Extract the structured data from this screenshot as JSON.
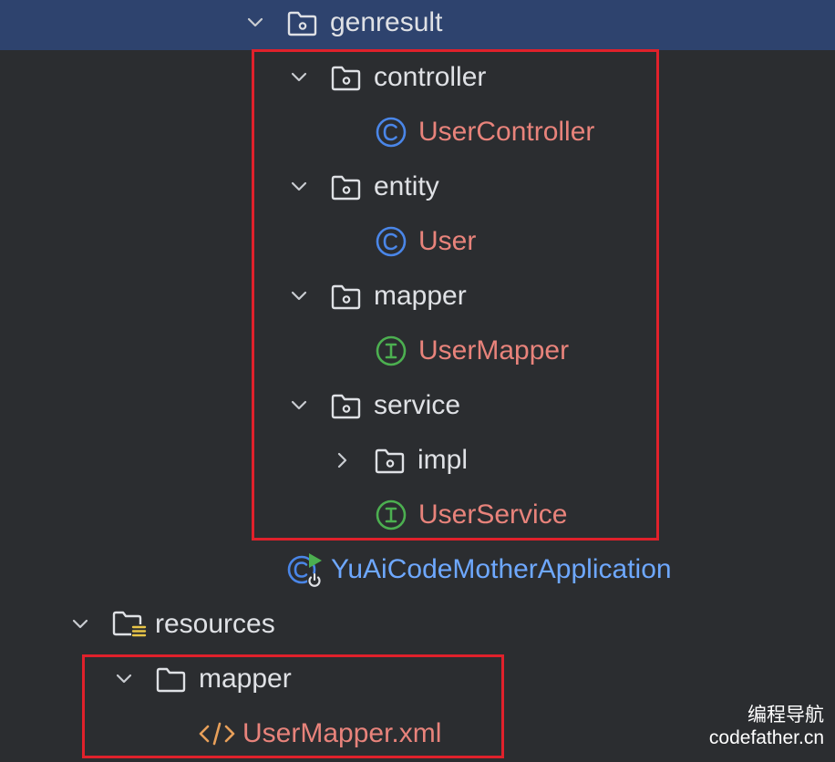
{
  "tree": {
    "genresult": "genresult",
    "controller": "controller",
    "user_controller": "UserController",
    "entity": "entity",
    "user": "User",
    "mapper": "mapper",
    "user_mapper": "UserMapper",
    "service": "service",
    "impl": "impl",
    "user_service": "UserService",
    "application": "YuAiCodeMotherApplication",
    "resources": "resources",
    "res_mapper": "mapper",
    "user_mapper_xml": "UserMapper.xml"
  },
  "watermark": {
    "line1": "编程导航",
    "line2": "codefather.cn"
  },
  "colors": {
    "background": "#2b2d30",
    "selected_row": "#2e436e",
    "highlight_box": "#e0212b",
    "modified_file": "#e8837b",
    "class_icon": "#4a86e8",
    "interface_icon": "#4caf50",
    "xml_icon": "#e8a05a"
  }
}
